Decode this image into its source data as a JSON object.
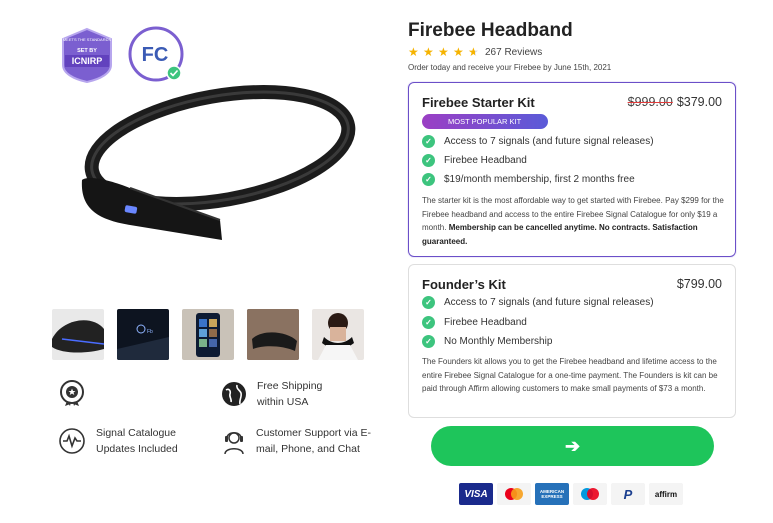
{
  "badges": {
    "icnirp_top": "MEETS THE STANDARDS",
    "icnirp_mid": "SET BY",
    "icnirp_main": "ICNIRP",
    "fcc": "FC"
  },
  "thumbnails": [
    "band-closeup",
    "band-on-surface",
    "phone-app",
    "band-worn",
    "person-wearing"
  ],
  "features": [
    {
      "icon": "award-icon",
      "text": ""
    },
    {
      "icon": "globe-icon",
      "text": "Free Shipping within USA"
    },
    {
      "icon": "signal-icon",
      "text": "Signal Catalogue Updates Included"
    },
    {
      "icon": "headset-icon",
      "text": "Customer Support via E-mail, Phone, and Chat"
    }
  ],
  "product": {
    "title": "Firebee Headband",
    "rating": 4.5,
    "reviews": "267 Reviews",
    "delivery": "Order today and receive your Firebee by June 15th, 2021"
  },
  "starter": {
    "name": "Firebee Starter Kit",
    "old_price": "$999.00",
    "price": "$379.00",
    "badge": "MOST POPULAR KIT",
    "bullets": [
      "Access to 7 signals (and future signal releases)",
      "Firebee Headband",
      "$19/month membership, first 2 months free"
    ],
    "desc": "The starter kit is the most affordable way to get started with Firebee. Pay $299 for the Firebee headband and access to the entire Firebee Signal Catalogue for only $19 a month.",
    "desc_bold": "Membership can be cancelled anytime. No contracts. Satisfaction guaranteed."
  },
  "founder": {
    "name": "Founder’s Kit",
    "price": "$799.00",
    "bullets": [
      "Access to 7 signals (and future signal releases)",
      "Firebee Headband",
      "No Monthly Membership"
    ],
    "desc": "The Founders kit allows you to get the Firebee headband and lifetime access to the entire Firebee Signal Catalogue for a one-time payment. The Founders is kit can be paid through Affirm allowing customers to make small payments of $73 a month."
  },
  "cta": {
    "arrow": "➔"
  },
  "payments": [
    {
      "name": "visa",
      "label": "VISA",
      "bg": "#1a2a8c",
      "color": "#ffffff"
    },
    {
      "name": "mastercard",
      "label": "",
      "bg": "#f4f4f4",
      "color": "#222222"
    },
    {
      "name": "amex",
      "label": "AMERICAN EXPRESS",
      "bg": "#2671b9",
      "color": "#ffffff"
    },
    {
      "name": "maestro",
      "label": "",
      "bg": "#f4f4f4",
      "color": "#222222"
    },
    {
      "name": "paypal",
      "label": "P",
      "bg": "#f4f4f4",
      "color": "#1b3f8f"
    },
    {
      "name": "affirm",
      "label": "affirm",
      "bg": "#f4f4f4",
      "color": "#111111"
    }
  ],
  "colors": {
    "accent": "#6b4fc8",
    "cta": "#1ec55b",
    "check": "#3dc47e",
    "star": "#f5b301"
  }
}
